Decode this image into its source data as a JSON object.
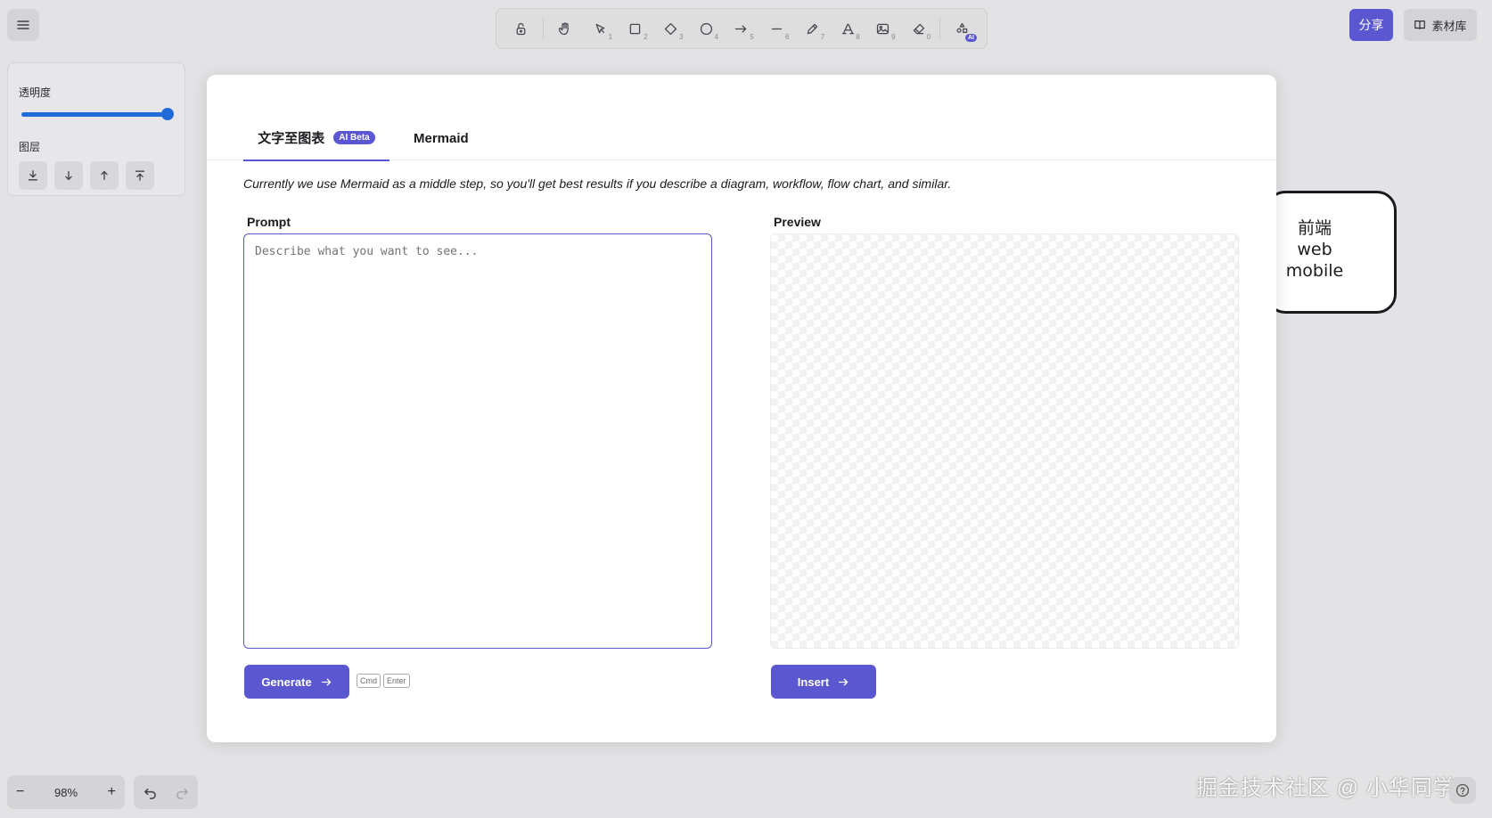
{
  "toolbar": {
    "tools": [
      {
        "icon": "lock-icon",
        "key": ""
      },
      {
        "icon": "hand-icon",
        "key": ""
      },
      {
        "icon": "pointer-icon",
        "key": "1"
      },
      {
        "icon": "rectangle-icon",
        "key": "2"
      },
      {
        "icon": "diamond-icon",
        "key": "3"
      },
      {
        "icon": "ellipse-icon",
        "key": "4"
      },
      {
        "icon": "arrow-icon",
        "key": "5"
      },
      {
        "icon": "line-icon",
        "key": "6"
      },
      {
        "icon": "pencil-icon",
        "key": "7"
      },
      {
        "icon": "text-icon",
        "key": "8"
      },
      {
        "icon": "image-icon",
        "key": "9"
      },
      {
        "icon": "eraser-icon",
        "key": "0"
      },
      {
        "icon": "ai-shapes-icon",
        "key": ""
      }
    ],
    "ai_badge": "AI"
  },
  "header": {
    "share_label": "分享",
    "library_label": "素材库"
  },
  "properties": {
    "opacity_label": "透明度",
    "opacity_value": 1.0,
    "layers_label": "图层"
  },
  "canvas": {
    "shape_lines": [
      "前端",
      "web",
      "mobile"
    ]
  },
  "footer": {
    "zoom_level": "98%",
    "zoom_out": "−",
    "zoom_in": "+"
  },
  "dialog": {
    "tabs": [
      {
        "label": "文字至图表",
        "badge": "AI Beta"
      },
      {
        "label": "Mermaid"
      }
    ],
    "intro": "Currently we use Mermaid as a middle step, so you'll get best results if you describe a diagram, workflow, flow chart, and similar.",
    "prompt_label": "Prompt",
    "prompt_placeholder": "Describe what you want to see...",
    "preview_label": "Preview",
    "generate_label": "Generate",
    "insert_label": "Insert",
    "shortcut_keys": [
      "Cmd",
      "Enter"
    ]
  },
  "watermark": "掘金技术社区 @ 小华同学ai",
  "colors": {
    "accent": "#5b57d1",
    "slider": "#1f6bd9",
    "background": "#e3e3e5"
  }
}
